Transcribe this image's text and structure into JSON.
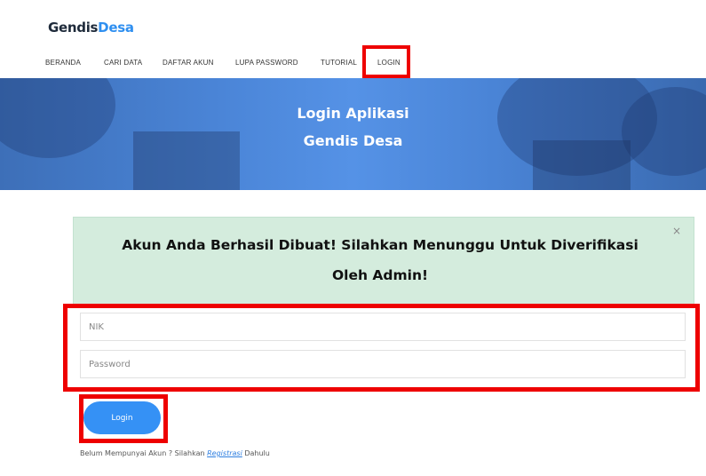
{
  "brand": {
    "part1": "Gendis",
    "part2": "Desa"
  },
  "nav": {
    "items": [
      {
        "label": "BERANDA"
      },
      {
        "label": "CARI DATA"
      },
      {
        "label": "DAFTAR AKUN"
      },
      {
        "label": "LUPA PASSWORD"
      },
      {
        "label": "TUTORIAL"
      },
      {
        "label": "LOGIN"
      }
    ]
  },
  "hero": {
    "line1": "Login Aplikasi",
    "line2": "Gendis Desa"
  },
  "alert": {
    "line1": "Akun Anda Berhasil Dibuat! Silahkan Menunggu Untuk Diverifikasi",
    "line2": "Oleh Admin!",
    "close": "×"
  },
  "form": {
    "nik_placeholder": "NIK",
    "password_placeholder": "Password",
    "submit_label": "Login"
  },
  "footer": {
    "prefix": "Belum Mempunyai Akun ? Silahkan",
    "link": "Registrasi",
    "suffix": "Dahulu"
  },
  "colors": {
    "accent": "#3591f5",
    "highlight": "#ee0000",
    "alert_bg": "#d4ecdd"
  }
}
